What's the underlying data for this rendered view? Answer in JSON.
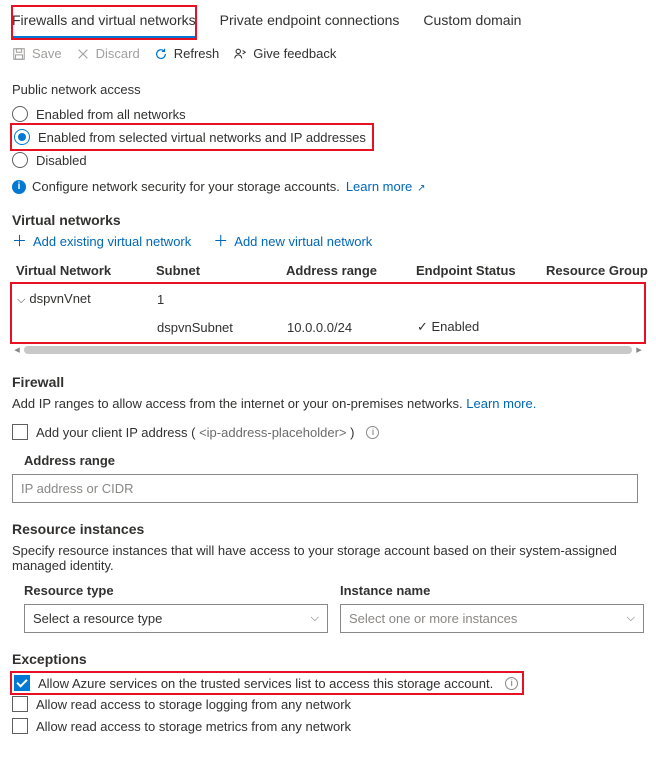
{
  "tabs": {
    "firewalls": "Firewalls and virtual networks",
    "private_ep": "Private endpoint connections",
    "custom_domain": "Custom domain"
  },
  "toolbar": {
    "save": "Save",
    "discard": "Discard",
    "refresh": "Refresh",
    "feedback": "Give feedback"
  },
  "public_access": {
    "heading": "Public network access",
    "opt_all": "Enabled from all networks",
    "opt_selected": "Enabled from selected virtual networks and IP addresses",
    "opt_disabled": "Disabled",
    "selected_value": "selected"
  },
  "info": {
    "text": "Configure network security for your storage accounts.",
    "learn_more": "Learn more"
  },
  "vnet": {
    "heading": "Virtual networks",
    "add_existing": "Add existing virtual network",
    "add_new": "Add new virtual network",
    "cols": {
      "network": "Virtual Network",
      "subnet": "Subnet",
      "address": "Address range",
      "endpoint": "Endpoint Status",
      "rg": "Resource Group"
    },
    "rows": [
      {
        "network": "dspvnVnet",
        "subnet_count": "1",
        "subnet": "",
        "address": "",
        "endpoint": "",
        "rg": ""
      },
      {
        "network": "",
        "subnet_count": "",
        "subnet": "dspvnSubnet",
        "address": "10.0.0.0/24",
        "endpoint": "Enabled",
        "rg": ""
      }
    ]
  },
  "firewall": {
    "heading": "Firewall",
    "desc": "Add IP ranges to allow access from the internet or your on-premises networks.",
    "learn_more": "Learn more.",
    "add_client_prefix": "Add your client IP address ( ",
    "add_client_ip": "<ip-address-placeholder>",
    "add_client_suffix": " )",
    "field_label": "Address range",
    "placeholder": "IP address or CIDR"
  },
  "resources": {
    "heading": "Resource instances",
    "desc": "Specify resource instances that will have access to your storage account based on their system-assigned managed identity.",
    "type_label": "Resource type",
    "instance_label": "Instance name",
    "type_placeholder": "Select a resource type",
    "instance_placeholder": "Select one or more instances"
  },
  "exceptions": {
    "heading": "Exceptions",
    "allow_trusted": "Allow Azure services on the trusted services list to access this storage account.",
    "allow_logging": "Allow read access to storage logging from any network",
    "allow_metrics": "Allow read access to storage metrics from any network"
  }
}
